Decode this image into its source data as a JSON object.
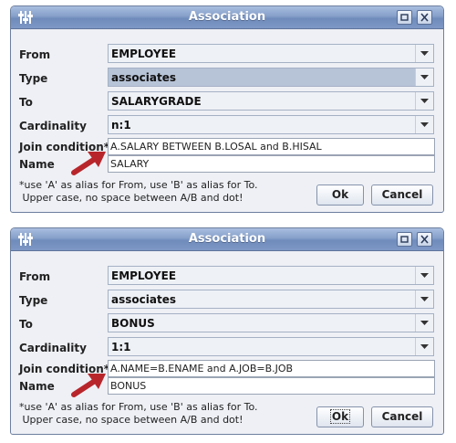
{
  "dialogs": [
    {
      "title": "Association",
      "icons": {
        "app": "app-icon",
        "restore": "restore-icon",
        "close": "close-icon"
      },
      "fields": {
        "from": {
          "label": "From",
          "value": "EMPLOYEE"
        },
        "type": {
          "label": "Type",
          "value": "associates"
        },
        "to": {
          "label": "To",
          "value": "SALARYGRADE"
        },
        "cardinality": {
          "label": "Cardinality",
          "value": "n:1"
        },
        "join_condition": {
          "label": "Join condition*",
          "value": "A.SALARY BETWEEN B.LOSAL and B.HISAL"
        },
        "name": {
          "label": "Name",
          "value": "SALARY"
        }
      },
      "hint_line1": "*use 'A' as alias for From, use 'B' as alias for To.",
      "hint_line2": " Upper case, no space between A/B and dot!",
      "ok_label": "Ok",
      "cancel_label": "Cancel"
    },
    {
      "title": "Association",
      "icons": {
        "app": "app-icon",
        "restore": "restore-icon",
        "close": "close-icon"
      },
      "fields": {
        "from": {
          "label": "From",
          "value": "EMPLOYEE"
        },
        "type": {
          "label": "Type",
          "value": "associates"
        },
        "to": {
          "label": "To",
          "value": "BONUS"
        },
        "cardinality": {
          "label": "Cardinality",
          "value": "1:1"
        },
        "join_condition": {
          "label": "Join condition*",
          "value": "A.NAME=B.ENAME and A.JOB=B.JOB"
        },
        "name": {
          "label": "Name",
          "value": "BONUS"
        }
      },
      "hint_line1": "*use 'A' as alias for From, use 'B' as alias for To.",
      "hint_line2": " Upper case, no space between A/B and dot!",
      "ok_label": "Ok",
      "cancel_label": "Cancel"
    }
  ],
  "colors": {
    "title_bar": "#7e98c5",
    "annotation_arrow": "#b8262b"
  }
}
